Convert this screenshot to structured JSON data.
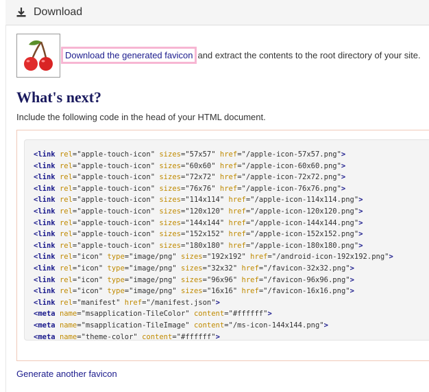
{
  "panel": {
    "title": "Download",
    "icon": "download-icon"
  },
  "download": {
    "logo_icon": "cherry-icon",
    "link_label": "Download the generated favicon",
    "after_text": " and extract the contents to the root directory of your site."
  },
  "whats_next": {
    "heading": "What's next?",
    "intro": "Include the following code in the head of your HTML document."
  },
  "code_lines": [
    {
      "tag": "link",
      "attrs": [
        [
          "rel",
          "apple-touch-icon"
        ],
        [
          "sizes",
          "57x57"
        ],
        [
          "href",
          "/apple-icon-57x57.png"
        ]
      ]
    },
    {
      "tag": "link",
      "attrs": [
        [
          "rel",
          "apple-touch-icon"
        ],
        [
          "sizes",
          "60x60"
        ],
        [
          "href",
          "/apple-icon-60x60.png"
        ]
      ]
    },
    {
      "tag": "link",
      "attrs": [
        [
          "rel",
          "apple-touch-icon"
        ],
        [
          "sizes",
          "72x72"
        ],
        [
          "href",
          "/apple-icon-72x72.png"
        ]
      ]
    },
    {
      "tag": "link",
      "attrs": [
        [
          "rel",
          "apple-touch-icon"
        ],
        [
          "sizes",
          "76x76"
        ],
        [
          "href",
          "/apple-icon-76x76.png"
        ]
      ]
    },
    {
      "tag": "link",
      "attrs": [
        [
          "rel",
          "apple-touch-icon"
        ],
        [
          "sizes",
          "114x114"
        ],
        [
          "href",
          "/apple-icon-114x114.png"
        ]
      ]
    },
    {
      "tag": "link",
      "attrs": [
        [
          "rel",
          "apple-touch-icon"
        ],
        [
          "sizes",
          "120x120"
        ],
        [
          "href",
          "/apple-icon-120x120.png"
        ]
      ]
    },
    {
      "tag": "link",
      "attrs": [
        [
          "rel",
          "apple-touch-icon"
        ],
        [
          "sizes",
          "144x144"
        ],
        [
          "href",
          "/apple-icon-144x144.png"
        ]
      ]
    },
    {
      "tag": "link",
      "attrs": [
        [
          "rel",
          "apple-touch-icon"
        ],
        [
          "sizes",
          "152x152"
        ],
        [
          "href",
          "/apple-icon-152x152.png"
        ]
      ]
    },
    {
      "tag": "link",
      "attrs": [
        [
          "rel",
          "apple-touch-icon"
        ],
        [
          "sizes",
          "180x180"
        ],
        [
          "href",
          "/apple-icon-180x180.png"
        ]
      ]
    },
    {
      "tag": "link",
      "attrs": [
        [
          "rel",
          "icon"
        ],
        [
          "type",
          "image/png"
        ],
        [
          "sizes",
          "192x192"
        ],
        [
          "href",
          "/android-icon-192x192.png"
        ]
      ]
    },
    {
      "tag": "link",
      "attrs": [
        [
          "rel",
          "icon"
        ],
        [
          "type",
          "image/png"
        ],
        [
          "sizes",
          "32x32"
        ],
        [
          "href",
          "/favicon-32x32.png"
        ]
      ]
    },
    {
      "tag": "link",
      "attrs": [
        [
          "rel",
          "icon"
        ],
        [
          "type",
          "image/png"
        ],
        [
          "sizes",
          "96x96"
        ],
        [
          "href",
          "/favicon-96x96.png"
        ]
      ]
    },
    {
      "tag": "link",
      "attrs": [
        [
          "rel",
          "icon"
        ],
        [
          "type",
          "image/png"
        ],
        [
          "sizes",
          "16x16"
        ],
        [
          "href",
          "/favicon-16x16.png"
        ]
      ]
    },
    {
      "tag": "link",
      "attrs": [
        [
          "rel",
          "manifest"
        ],
        [
          "href",
          "/manifest.json"
        ]
      ]
    },
    {
      "tag": "meta",
      "attrs": [
        [
          "name",
          "msapplication-TileColor"
        ],
        [
          "content",
          "#ffffff"
        ]
      ]
    },
    {
      "tag": "meta",
      "attrs": [
        [
          "name",
          "msapplication-TileImage"
        ],
        [
          "content",
          "/ms-icon-144x144.png"
        ]
      ]
    },
    {
      "tag": "meta",
      "attrs": [
        [
          "name",
          "theme-color"
        ],
        [
          "content",
          "#ffffff"
        ]
      ]
    }
  ],
  "footer": {
    "another_link": "Generate another favicon"
  },
  "colors": {
    "link": "#1a1a8c",
    "heading": "#1a1a5e",
    "highlight_border": "#f7b6d3",
    "code_attr": "#c08a00",
    "cherry_red": "#e02b2b",
    "stem_brown": "#7a4a2a",
    "leaf_green": "#5a8f2a"
  }
}
